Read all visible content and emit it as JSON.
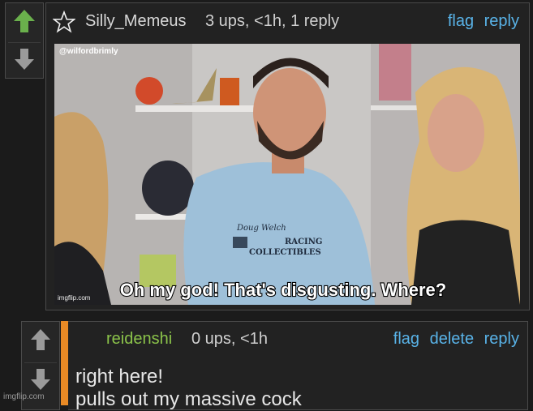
{
  "comment1": {
    "username": "Silly_Memeus",
    "meta": "3 ups, <1h, 1 reply",
    "actions": [
      "flag",
      "reply"
    ],
    "image": {
      "watermark_top": "@wilfordbrimly",
      "caption": "Oh my god! That's disgusting. Where?",
      "shirt_text_1": "Doug Welch",
      "shirt_text_2": "RACING",
      "shirt_text_3": "COLLECTIBLES",
      "corner_watermark": "imgflip.com"
    }
  },
  "comment2": {
    "username": "reidenshi",
    "meta": "0 ups, <1h",
    "actions": [
      "flag",
      "delete",
      "reply"
    ],
    "text": "right here!\npulls out my massive cock"
  },
  "page_watermark": "imgflip.com",
  "colors": {
    "upvote_active": "#6ab04c",
    "link": "#59b3e8",
    "op_username": "#8bc34a",
    "accent_bar": "#e98a25"
  }
}
